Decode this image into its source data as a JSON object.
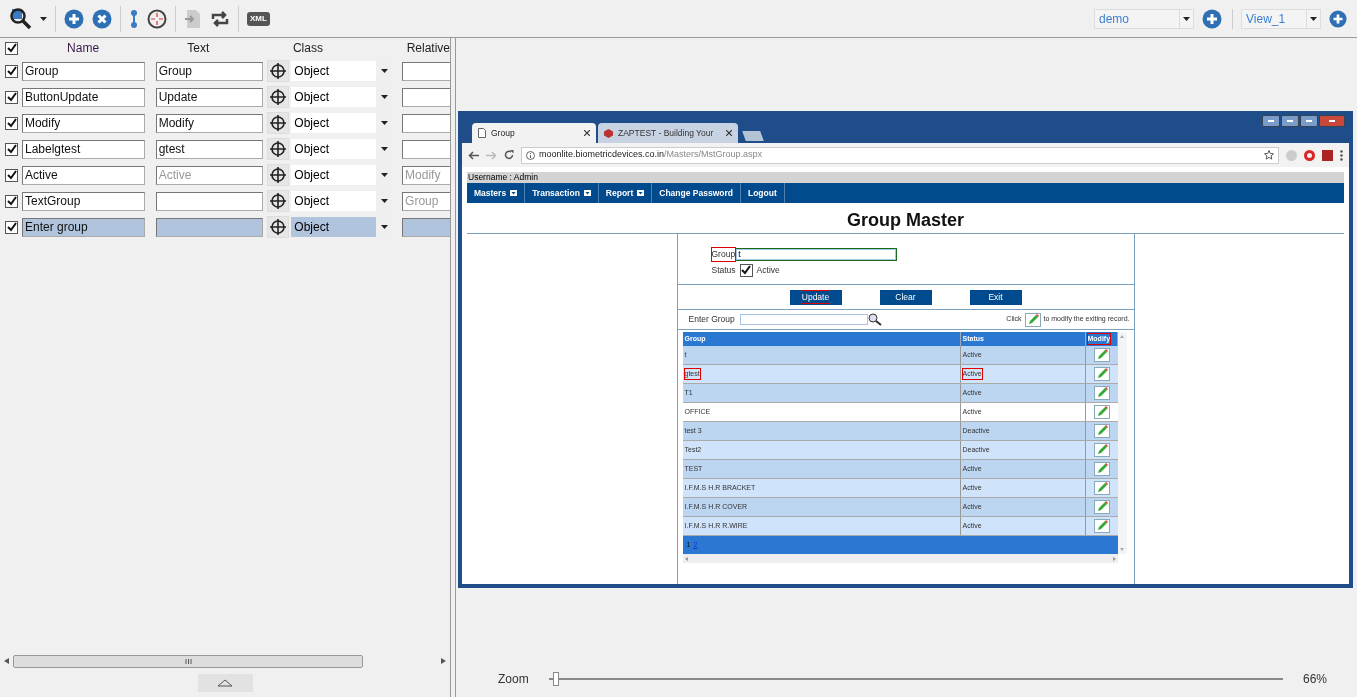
{
  "toolbar": {
    "xml_label": "XML",
    "project": "demo",
    "view": "View_1"
  },
  "object_table": {
    "all_checked": true,
    "columns": [
      "Name",
      "Text",
      "Class",
      "Relative"
    ],
    "rows": [
      {
        "checked": true,
        "name": "Group",
        "text": "Group",
        "class": "Object",
        "selected": false
      },
      {
        "checked": true,
        "name": "ButtonUpdate",
        "text": "Update",
        "class": "Object",
        "selected": false
      },
      {
        "checked": true,
        "name": "Modify",
        "text": "Modify",
        "class": "Object",
        "selected": false
      },
      {
        "checked": true,
        "name": "Labelgtest",
        "text": "gtest",
        "class": "Object",
        "selected": false
      },
      {
        "checked": true,
        "name": "Active",
        "text_placeholder": "Active",
        "class": "Object",
        "relative_placeholder": "Modify",
        "selected": false
      },
      {
        "checked": true,
        "name": "TextGroup",
        "class": "Object",
        "relative_placeholder": "Group",
        "selected": false
      },
      {
        "checked": true,
        "name": "Enter group",
        "class": "Object",
        "selected": true
      }
    ]
  },
  "browser": {
    "tabs": [
      {
        "title": "Group",
        "selected": true
      },
      {
        "title": "ZAPTEST - Building Your",
        "selected": false
      }
    ],
    "url_host": "moonlite.biometricdevices.co.in",
    "url_path": "/Masters/MstGroup.aspx",
    "page": {
      "username": "Username : Admin",
      "menu": [
        {
          "label": "Masters",
          "dropdown": true
        },
        {
          "label": "Transaction",
          "dropdown": true
        },
        {
          "label": "Report",
          "dropdown": true
        },
        {
          "label": "Change Password",
          "dropdown": false
        },
        {
          "label": "Logout",
          "dropdown": false
        }
      ],
      "title": "Group Master",
      "group_label": "Group",
      "group_label_highlighted": true,
      "group_value": "t",
      "group_field_selected": true,
      "status_label": "Status",
      "active_label": "Active",
      "active_checked": true,
      "buttons": [
        {
          "label": "Update",
          "highlighted": true
        },
        {
          "label": "Clear",
          "highlighted": false
        },
        {
          "label": "Exit",
          "highlighted": false
        }
      ],
      "search_label": "Enter Group",
      "hint_before": "Click",
      "hint_after": "to modify the exiting record.",
      "columns": [
        {
          "label": "Group",
          "highlighted": false
        },
        {
          "label": "Status",
          "highlighted": false
        },
        {
          "label": "Modify",
          "highlighted": true
        }
      ],
      "rows": [
        {
          "group": "t",
          "status": "Active",
          "group_highlighted": false,
          "status_highlighted": false
        },
        {
          "group": "gtest",
          "status": "Active",
          "group_highlighted": true,
          "status_highlighted": true
        },
        {
          "group": "T1",
          "status": "Active",
          "group_highlighted": false,
          "status_highlighted": false
        },
        {
          "group": "OFFICE",
          "status": "Active",
          "group_highlighted": false,
          "status_highlighted": false
        },
        {
          "group": "test 3",
          "status": "Deactive",
          "group_highlighted": false,
          "status_highlighted": false
        },
        {
          "group": "Test2",
          "status": "Deactive",
          "group_highlighted": false,
          "status_highlighted": false
        },
        {
          "group": "TEST",
          "status": "Active",
          "group_highlighted": false,
          "status_highlighted": false
        },
        {
          "group": "I.F.M.S H.R BRACKET",
          "status": "Active",
          "group_highlighted": false,
          "status_highlighted": false
        },
        {
          "group": "I.F.M.S H.R COVER",
          "status": "Active",
          "group_highlighted": false,
          "status_highlighted": false
        },
        {
          "group": "I.F.M.S H.R R.WIRE",
          "status": "Active",
          "group_highlighted": false,
          "status_highlighted": false
        }
      ],
      "pages": [
        {
          "label": "1",
          "selected": true
        },
        {
          "label": "2",
          "selected": false
        }
      ]
    }
  },
  "zoom": {
    "label": "Zoom",
    "level": 0.01,
    "reading": "66%"
  }
}
